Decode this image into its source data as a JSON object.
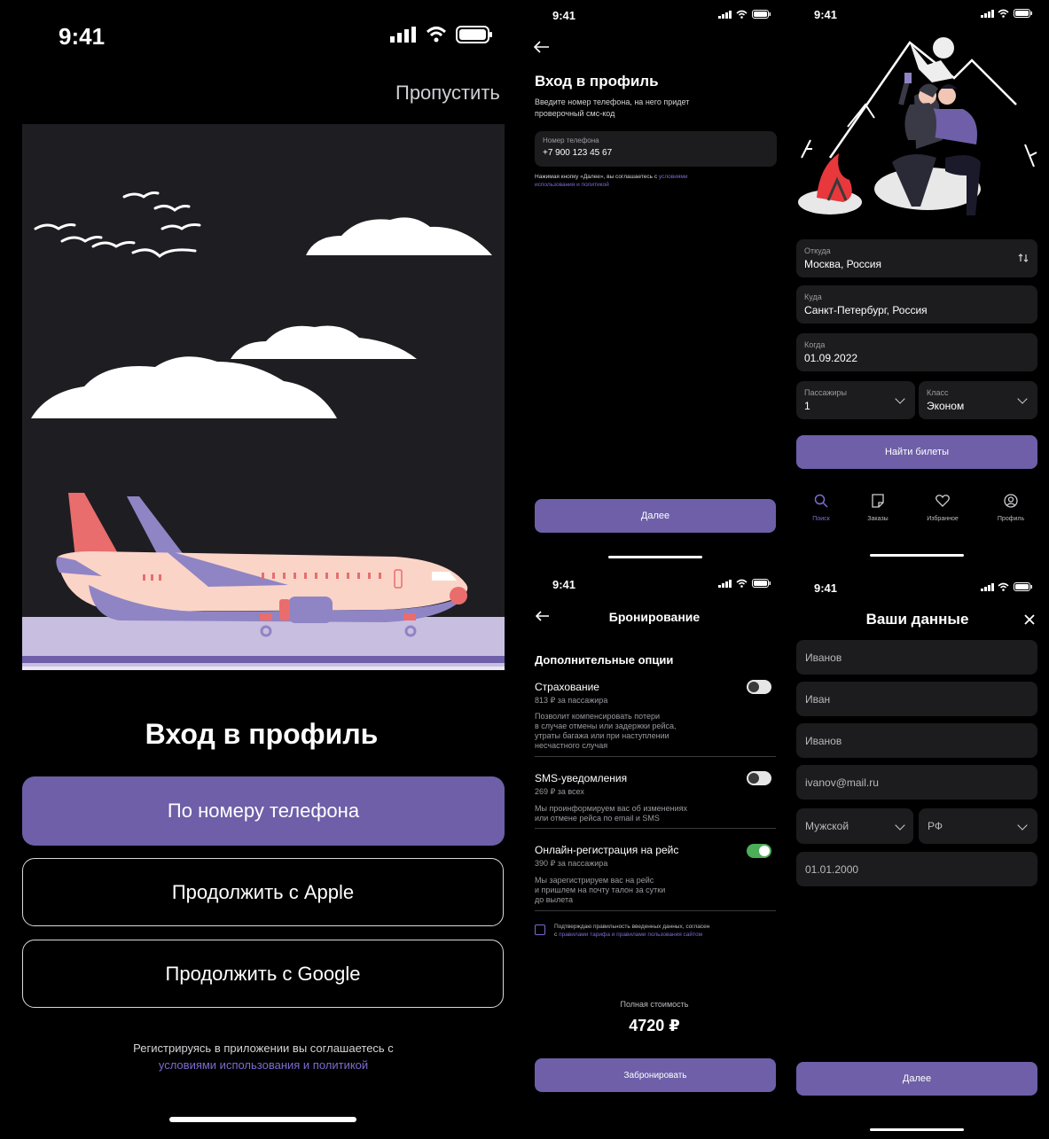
{
  "status": {
    "time": "9:41"
  },
  "login": {
    "skip": "Пропустить",
    "title": "Вход в профиль",
    "phone_button": "По номеру телефона",
    "apple_button": "Продолжить с Apple",
    "google_button": "Продолжить с Google",
    "terms_text": "Регистрируясь в приложении вы соглашаетесь с",
    "terms_link": "условиями использования и политикой"
  },
  "phone": {
    "title": "Вход в профиль",
    "subtitle_line1": "Введите номер телефона, на него придет",
    "subtitle_line2": "проверочный смс-код",
    "field_label": "Номер телефона",
    "field_value": "+7 900 123 45 67",
    "consent_prefix": "Нажимая кнопку «Далее», вы соглашаетесь с",
    "consent_link1": "условиями",
    "consent_link2": "использования и политикой",
    "next_button": "Далее"
  },
  "search": {
    "from_label": "Откуда",
    "from_value": "Москва, Россия",
    "to_label": "Куда",
    "to_value": "Санкт-Петербург, Россия",
    "when_label": "Когда",
    "when_value": "01.09.2022",
    "pax_label": "Пассажиры",
    "pax_value": "1",
    "class_label": "Класс",
    "class_value": "Эконом",
    "find_button": "Найти билеты",
    "tabs": [
      {
        "label": "Поиск",
        "icon": "search-icon"
      },
      {
        "label": "Заказы",
        "icon": "orders-icon"
      },
      {
        "label": "Избранное",
        "icon": "heart-icon"
      },
      {
        "label": "Профиль",
        "icon": "profile-icon"
      }
    ]
  },
  "booking": {
    "title": "Бронирование",
    "section": "Дополнительные опции",
    "options": [
      {
        "title": "Страхование",
        "price": "813 ₽ за пассажира",
        "desc_lines": [
          "Позволит компенсировать потери",
          "в случае отмены или задержки рейса,",
          "утраты багажа или при наступлении",
          "несчастного случая"
        ],
        "enabled": false
      },
      {
        "title": "SMS-уведомления",
        "price": "269 ₽ за всех",
        "desc_lines": [
          "Мы проинформируем вас об изменениях",
          "или отмене рейса по email и SMS"
        ],
        "enabled": false
      },
      {
        "title": "Онлайн-регистрация на рейс",
        "price": "390 ₽ за пассажира",
        "desc_lines": [
          "Мы зарегистрируем вас на рейс",
          "и пришлем на почту талон за сутки",
          "до вылета"
        ],
        "enabled": true
      }
    ],
    "confirm_line1": "Подтверждаю правильность введенных данных, согласен",
    "confirm_line2_prefix": "с",
    "confirm_link": "правилами тарифа и правилами пользования сайтом",
    "total_label": "Полная стоимость",
    "total_value": "4720 ₽",
    "book_button": "Забронировать"
  },
  "details": {
    "title": "Ваши данные",
    "last_name": "Иванов",
    "first_name": "Иван",
    "patronymic": "Иванов",
    "email": "ivanov@mail.ru",
    "gender": "Мужской",
    "citizenship": "РФ",
    "birth_date": "01.01.2000",
    "next_button": "Далее"
  },
  "colors": {
    "accent": "#6e5fa8",
    "link": "#7b6ccf",
    "field_bg": "#1c1c1e",
    "toggle_on": "#4cae57"
  }
}
